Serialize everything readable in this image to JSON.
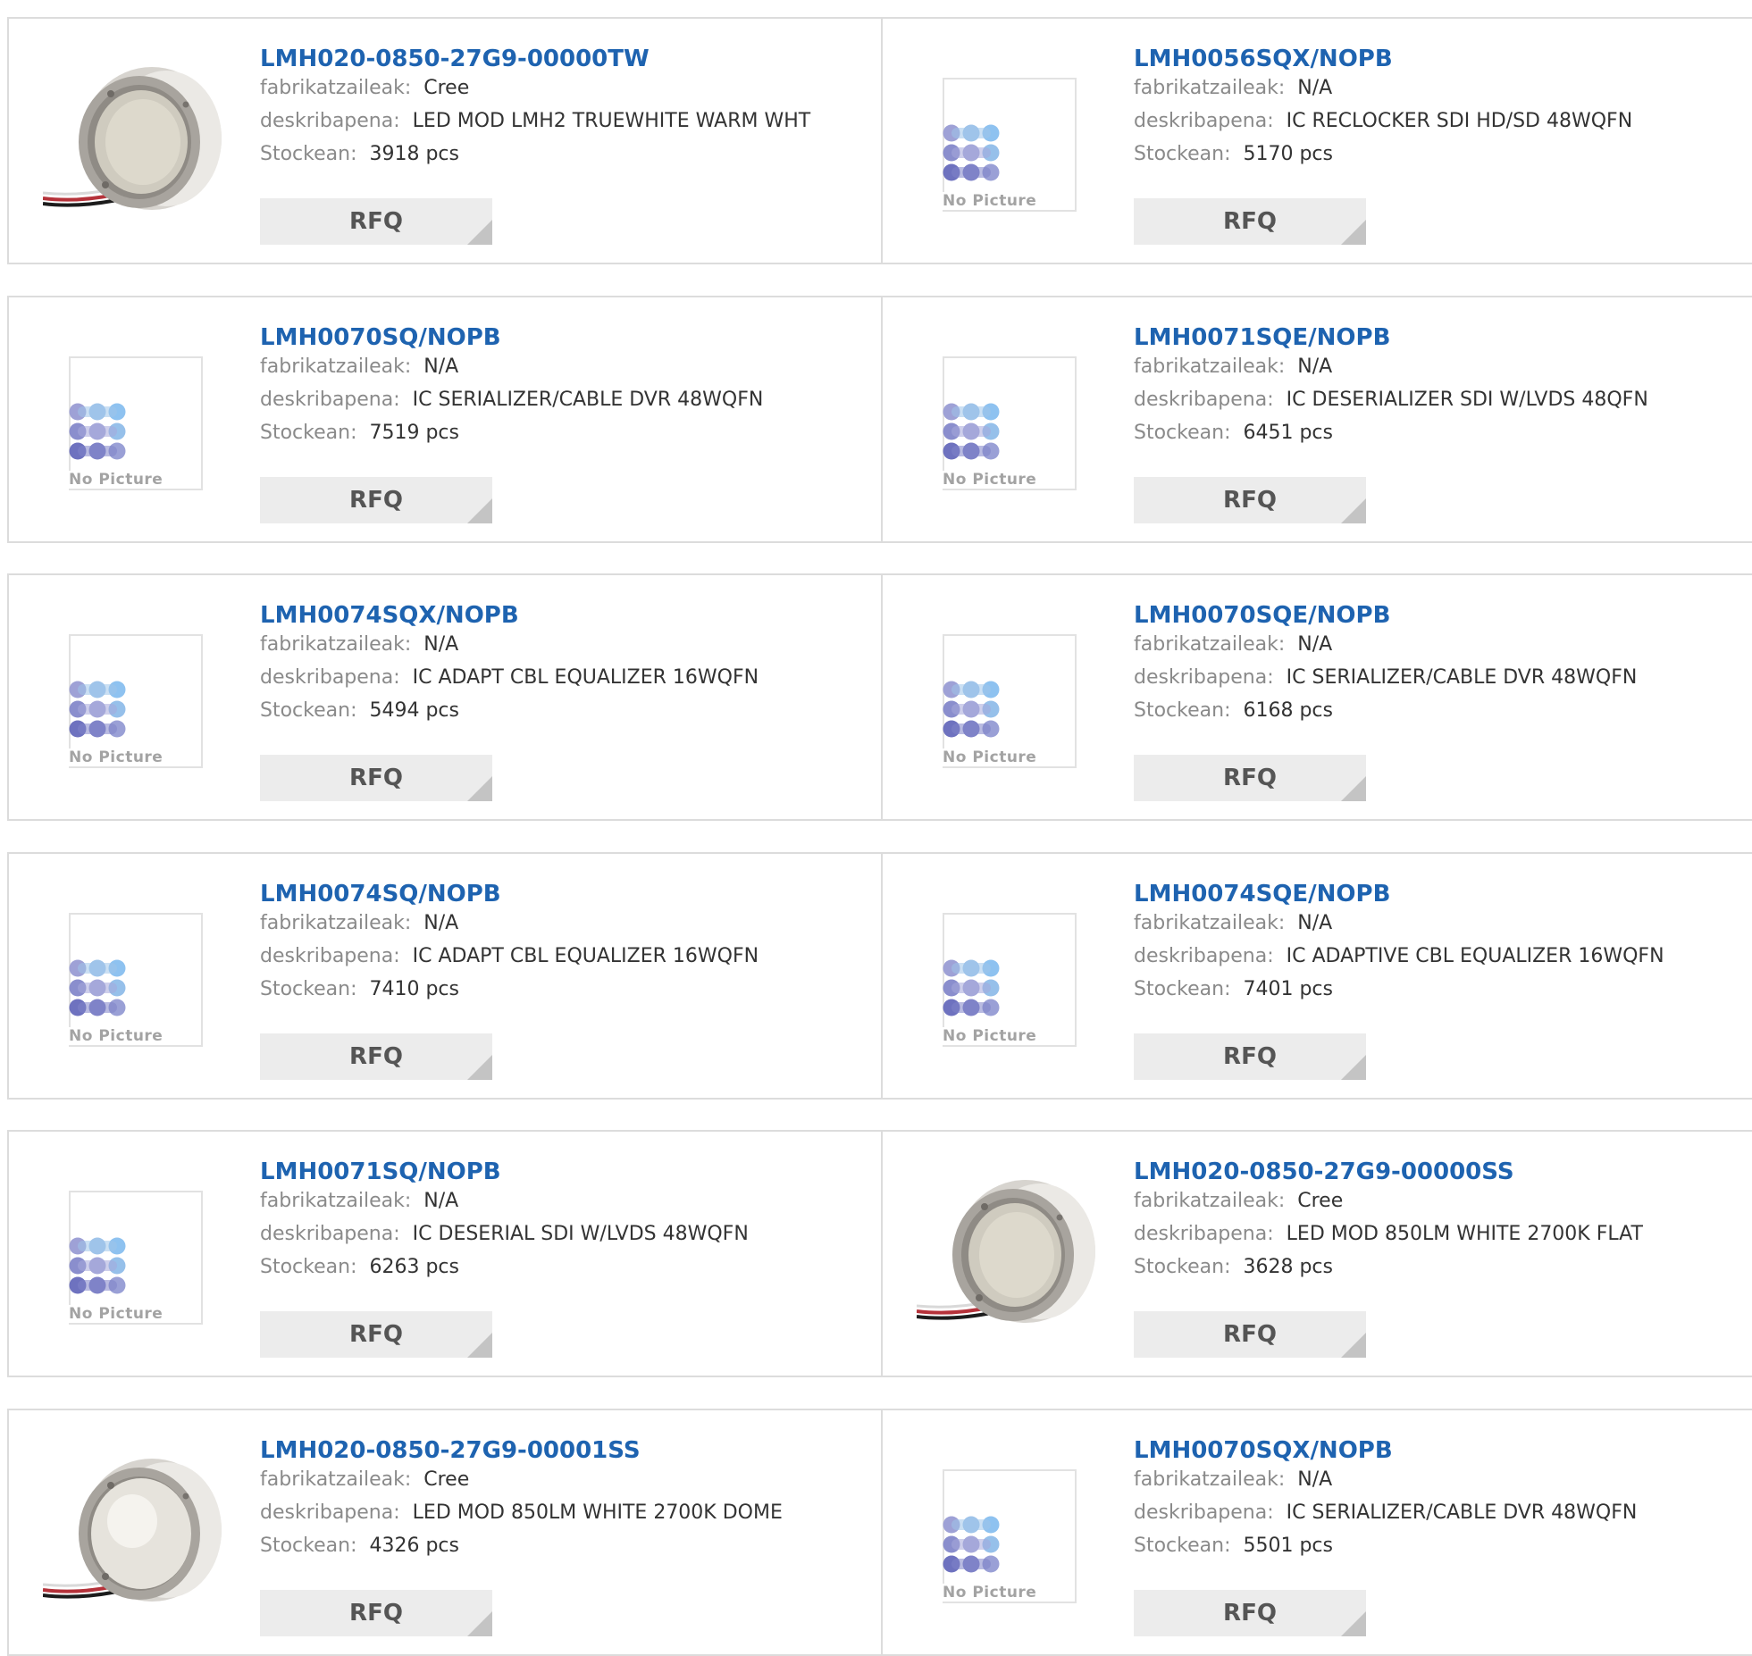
{
  "labels": {
    "manufacturer": "fabrikatzaileak:",
    "description": "deskribapena:",
    "stock": "Stockean:",
    "rfq": "RFQ",
    "no_picture": "No Picture"
  },
  "products": [
    {
      "part": "LMH020-0850-27G9-00000TW",
      "manufacturer": "Cree",
      "description": "LED MOD LMH2 TRUEWHITE WARM WHT",
      "stock": "3918 pcs",
      "image": "led-module-flat"
    },
    {
      "part": "LMH0056SQX/NOPB",
      "manufacturer": "N/A",
      "description": "IC RECLOCKER SDI HD/SD 48WQFN",
      "stock": "5170 pcs",
      "image": "no-picture"
    },
    {
      "part": "LMH0070SQ/NOPB",
      "manufacturer": "N/A",
      "description": "IC SERIALIZER/CABLE DVR 48WQFN",
      "stock": "7519 pcs",
      "image": "no-picture"
    },
    {
      "part": "LMH0071SQE/NOPB",
      "manufacturer": "N/A",
      "description": "IC DESERIALIZER SDI W/LVDS 48QFN",
      "stock": "6451 pcs",
      "image": "no-picture"
    },
    {
      "part": "LMH0074SQX/NOPB",
      "manufacturer": "N/A",
      "description": "IC ADAPT CBL EQUALIZER 16WQFN",
      "stock": "5494 pcs",
      "image": "no-picture"
    },
    {
      "part": "LMH0070SQE/NOPB",
      "manufacturer": "N/A",
      "description": "IC SERIALIZER/CABLE DVR 48WQFN",
      "stock": "6168 pcs",
      "image": "no-picture"
    },
    {
      "part": "LMH0074SQ/NOPB",
      "manufacturer": "N/A",
      "description": "IC ADAPT CBL EQUALIZER 16WQFN",
      "stock": "7410 pcs",
      "image": "no-picture"
    },
    {
      "part": "LMH0074SQE/NOPB",
      "manufacturer": "N/A",
      "description": "IC ADAPTIVE CBL EQUALIZER 16WQFN",
      "stock": "7401 pcs",
      "image": "no-picture"
    },
    {
      "part": "LMH0071SQ/NOPB",
      "manufacturer": "N/A",
      "description": "IC DESERIAL SDI W/LVDS 48WQFN",
      "stock": "6263 pcs",
      "image": "no-picture"
    },
    {
      "part": "LMH020-0850-27G9-00000SS",
      "manufacturer": "Cree",
      "description": "LED MOD 850LM WHITE 2700K FLAT",
      "stock": "3628 pcs",
      "image": "led-module-flat"
    },
    {
      "part": "LMH020-0850-27G9-00001SS",
      "manufacturer": "Cree",
      "description": "LED MOD 850LM WHITE 2700K DOME",
      "stock": "4326 pcs",
      "image": "led-module-dome"
    },
    {
      "part": "LMH0070SQX/NOPB",
      "manufacturer": "N/A",
      "description": "IC SERIALIZER/CABLE DVR 48WQFN",
      "stock": "5501 pcs",
      "image": "no-picture"
    }
  ],
  "colors": {
    "title": "#1e63b0",
    "label": "#8a8a8a",
    "value": "#333333",
    "border": "#dcdcdc",
    "rfq_bg": "#ececec",
    "rfq_text": "#555555"
  }
}
